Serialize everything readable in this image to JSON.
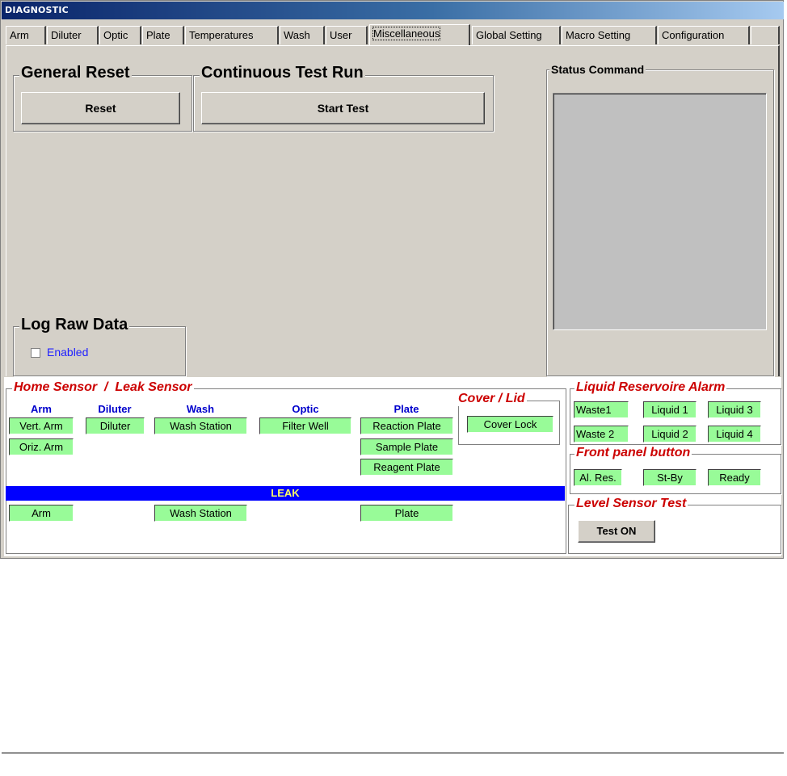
{
  "window": {
    "title": "DIAGNOSTIC"
  },
  "tabs": [
    {
      "label": "Arm"
    },
    {
      "label": "Diluter"
    },
    {
      "label": "Optic"
    },
    {
      "label": "Plate"
    },
    {
      "label": "Temperatures"
    },
    {
      "label": "Wash"
    },
    {
      "label": "User"
    },
    {
      "label": "Miscellaneous",
      "active": true
    },
    {
      "label": "Global Setting"
    },
    {
      "label": "Macro Setting"
    },
    {
      "label": "Configuration"
    }
  ],
  "misc": {
    "general_reset": {
      "title": "General Reset",
      "button": "Reset"
    },
    "continuous_test": {
      "title": "Continuous Test Run",
      "button": "Start Test"
    },
    "status_command": {
      "title": "Status Command"
    },
    "log_raw_data": {
      "title": "Log Raw Data",
      "checkbox_label": "Enabled",
      "checked": false
    }
  },
  "sensors": {
    "title_home": "Home Sensor",
    "separator": "/",
    "title_leak": "Leak Sensor",
    "columns": {
      "arm": "Arm",
      "diluter": "Diluter",
      "wash": "Wash",
      "optic": "Optic",
      "plate": "Plate"
    },
    "home": {
      "vert_arm": "Vert. Arm",
      "oriz_arm": "Oriz. Arm",
      "diluter": "Diluter",
      "wash_station": "Wash Station",
      "filter_well": "Filter Well",
      "reaction_plate": "Reaction Plate",
      "sample_plate": "Sample Plate",
      "reagent_plate": "Reagent Plate"
    },
    "cover": {
      "title": "Cover / Lid",
      "cover_lock": "Cover Lock"
    },
    "leak": {
      "banner": "LEAK",
      "arm": "Arm",
      "wash_station": "Wash Station",
      "plate": "Plate"
    },
    "indicator_color": "#98fb98"
  },
  "reservoir": {
    "title": "Liquid Reservoire Alarm",
    "items": {
      "waste1": "Waste1",
      "liquid1": "Liquid 1",
      "liquid3": "Liquid 3",
      "waste2": "Waste 2",
      "liquid2": "Liquid 2",
      "liquid4": "Liquid 4"
    }
  },
  "front_panel": {
    "title": "Front panel button",
    "items": {
      "al_res": "Al. Res.",
      "st_by": "St-By",
      "ready": "Ready"
    }
  },
  "level_sensor": {
    "title": "Level Sensor Test",
    "button": "Test ON"
  },
  "colors": {
    "leak_banner": "#0000ff",
    "leak_text": "#ffff66",
    "section_title": "#cc0000",
    "column_header": "#0000cc"
  }
}
